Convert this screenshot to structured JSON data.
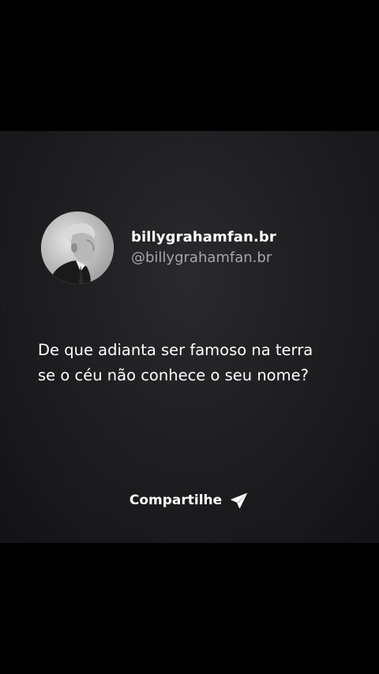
{
  "post": {
    "display_name": "billygrahamfan.br",
    "handle": "@billygrahamfan.br",
    "quote_lines": [
      "De que adianta ser famoso na terra",
      "se o céu não conhece o seu nome?"
    ],
    "share_label": "Compartilhe",
    "share_icon": "paper-plane-icon",
    "avatar_icon": "portrait-photo"
  },
  "colors": {
    "page_background": "#000000",
    "card_background": "#1f1f22",
    "text_primary": "#ffffff",
    "text_secondary": "#a7a7ab"
  }
}
